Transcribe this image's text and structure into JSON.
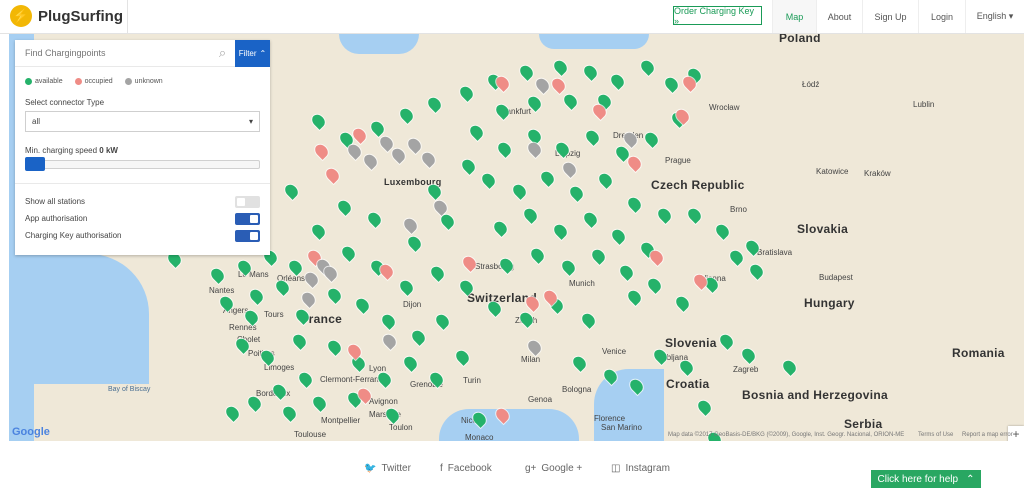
{
  "header": {
    "logo_text": "PlugSurfing",
    "order_button": "Order Charging Key »",
    "nav": [
      "Map",
      "About",
      "Sign Up",
      "Login",
      "English ▾"
    ]
  },
  "filter": {
    "search_placeholder": "Find Chargingpoints",
    "filter_button": "Filter",
    "legend": [
      "available",
      "occupied",
      "unknown"
    ],
    "connector_label": "Select connector Type",
    "connector_value": "all",
    "speed_label_prefix": "Min. charging speed",
    "speed_value": "0 kW",
    "options": [
      {
        "label": "Show all stations",
        "state": "off"
      },
      {
        "label": "App authorisation",
        "state": "on"
      },
      {
        "label": "Charging Key authorisation",
        "state": "on"
      }
    ]
  },
  "map": {
    "countries": [
      "Poland",
      "Czech Republic",
      "Slovakia",
      "Hungary",
      "Romania",
      "Slovenia",
      "Croatia",
      "Bosnia and Herzegovina",
      "Serbia",
      "France",
      "Switzerland",
      "Luxembourg"
    ],
    "cities": [
      "Lublin",
      "Łódź",
      "Prague",
      "Brno",
      "Bratislava",
      "Budapest",
      "Vienna",
      "Munich",
      "Zurich",
      "Lyon",
      "Toulouse",
      "Nantes",
      "Rennes",
      "Bordeaux",
      "Monaco",
      "San Marino",
      "Strasbourg",
      "Frankfurt",
      "Leipzig",
      "Dresden",
      "Wrocław",
      "Kraków",
      "Katowice",
      "Zagreb",
      "Ljubljana",
      "Venice",
      "Milan",
      "Turin",
      "Genoa",
      "Florence",
      "Bologna",
      "Toulon",
      "Marseille",
      "Montpellier",
      "Limoges",
      "Orléans",
      "Dijon",
      "Le Mans",
      "Tours",
      "Angers",
      "Cholet",
      "Poitiers",
      "Clermont-Ferrand",
      "Grenoble",
      "Avignon",
      "Nice",
      "Bay of Biscay"
    ],
    "attribution": "Map data ©2017 GeoBasis-DE/BKG (©2009), Google, Inst. Geogr. Nacional, ORION-ME",
    "terms": "Terms of Use",
    "report": "Report a map error",
    "google_logo": "Google"
  },
  "footer": {
    "links": [
      "Twitter",
      "Facebook",
      "Google +",
      "Instagram"
    ],
    "help_button": "Click here for help"
  },
  "colors": {
    "brand_green": "#1a9b57",
    "filter_blue": "#1a63c6",
    "available": "#25b26a",
    "occupied": "#ef8c86",
    "unknown": "#a4a4a4"
  },
  "icons": [
    "search-icon",
    "twitter-icon",
    "facebook-icon",
    "googleplus-icon",
    "instagram-icon",
    "chevron-up-icon",
    "plus-icon",
    "minus-icon",
    "bolt-icon"
  ]
}
